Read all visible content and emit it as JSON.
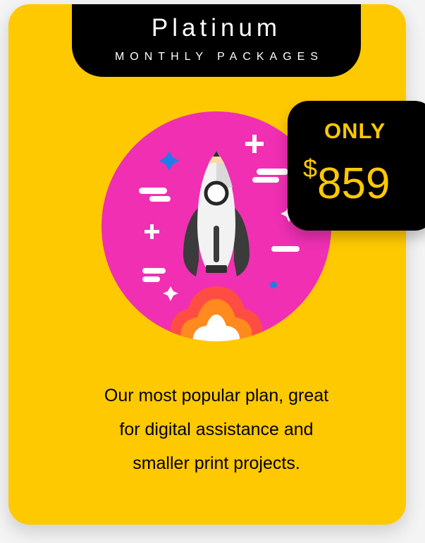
{
  "plan": {
    "name": "Platinum",
    "subtitle": "MONTHLY PACKAGES"
  },
  "price": {
    "prefix": "ONLY",
    "currency": "$",
    "amount": "859"
  },
  "description": {
    "lines": [
      "Our most popular plan, great",
      "for digital assistance and",
      "smaller print projects."
    ]
  },
  "illustration": {
    "icon": "rocket-launch-icon",
    "colors": {
      "circle": "#f02fb3",
      "rocket_body": "#f2f2f2",
      "rocket_dark": "#3b3b3b",
      "flame": "#ff8a1d",
      "sparkle_blue": "#1f7de7"
    }
  },
  "colors": {
    "card": "#ffc900",
    "tab": "#000000",
    "badge": "#000000",
    "badge_text": "#ffc900",
    "tab_text": "#ffffff"
  }
}
